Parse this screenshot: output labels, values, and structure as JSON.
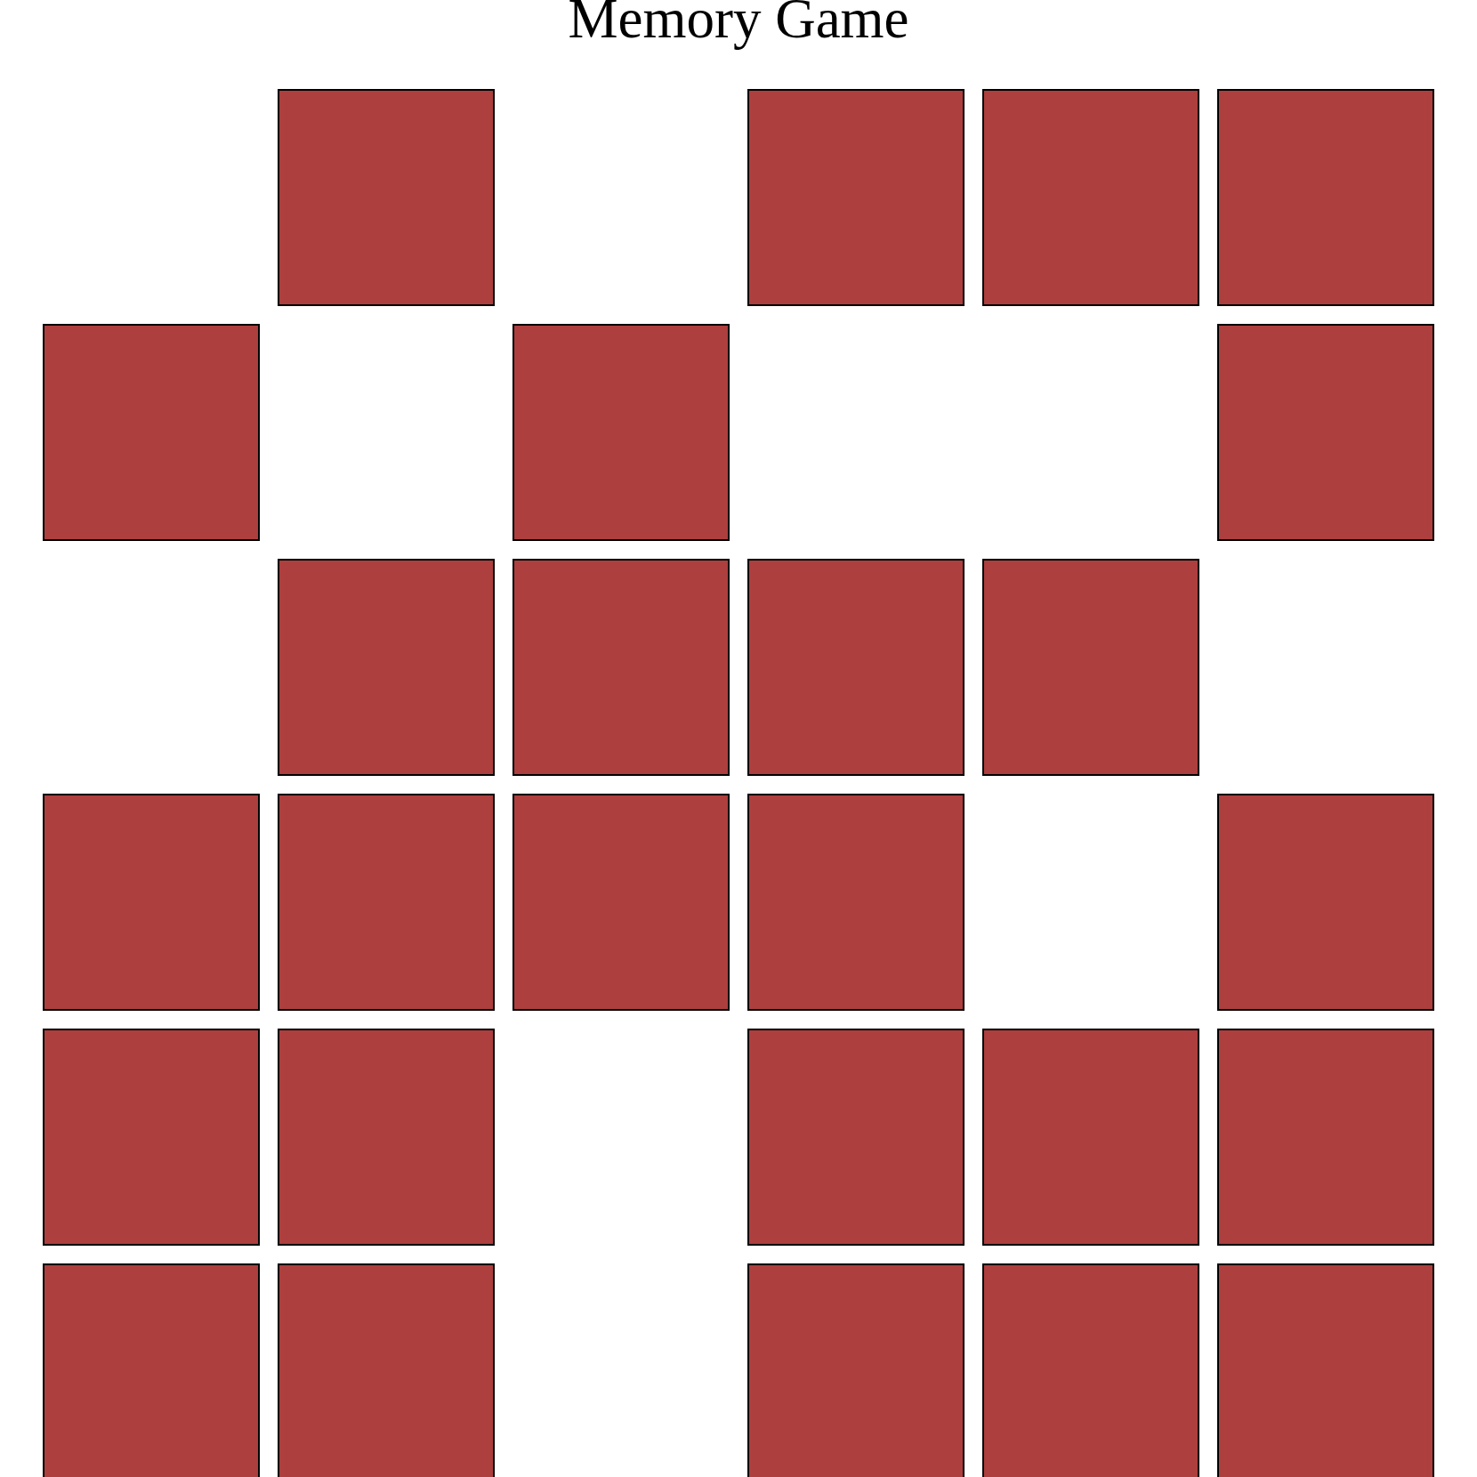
{
  "title": "Memory Game",
  "cards": [
    {
      "matched": true
    },
    {
      "matched": false
    },
    {
      "matched": true
    },
    {
      "matched": false
    },
    {
      "matched": false
    },
    {
      "matched": false
    },
    {
      "matched": false
    },
    {
      "matched": true
    },
    {
      "matched": false
    },
    {
      "matched": true
    },
    {
      "matched": true
    },
    {
      "matched": false
    },
    {
      "matched": true
    },
    {
      "matched": false
    },
    {
      "matched": false
    },
    {
      "matched": false
    },
    {
      "matched": false
    },
    {
      "matched": true
    },
    {
      "matched": false
    },
    {
      "matched": false
    },
    {
      "matched": false
    },
    {
      "matched": false
    },
    {
      "matched": true
    },
    {
      "matched": false
    },
    {
      "matched": false
    },
    {
      "matched": false
    },
    {
      "matched": true
    },
    {
      "matched": false
    },
    {
      "matched": false
    },
    {
      "matched": false
    },
    {
      "matched": false
    },
    {
      "matched": false
    },
    {
      "matched": true
    },
    {
      "matched": false
    },
    {
      "matched": false
    },
    {
      "matched": false
    }
  ]
}
